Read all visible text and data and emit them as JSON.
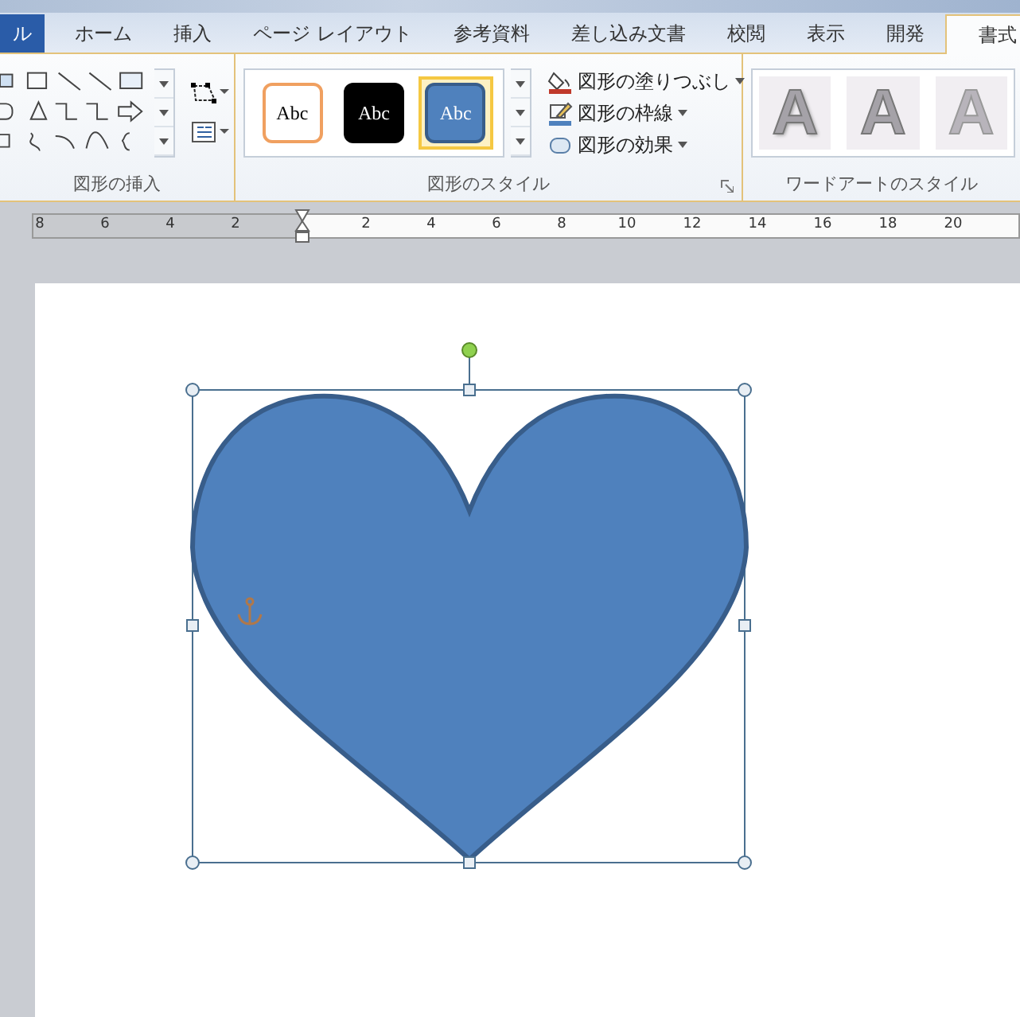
{
  "tabs": [
    {
      "label": "ル",
      "kind": "file",
      "selected": false
    },
    {
      "label": "ホーム",
      "kind": "tab",
      "selected": false
    },
    {
      "label": "挿入",
      "kind": "tab",
      "selected": false
    },
    {
      "label": "ページ レイアウト",
      "kind": "tab",
      "selected": false
    },
    {
      "label": "参考資料",
      "kind": "tab",
      "selected": false
    },
    {
      "label": "差し込み文書",
      "kind": "tab",
      "selected": false
    },
    {
      "label": "校閲",
      "kind": "tab",
      "selected": false
    },
    {
      "label": "表示",
      "kind": "tab",
      "selected": false
    },
    {
      "label": "開発",
      "kind": "tab",
      "selected": false
    },
    {
      "label": "書式",
      "kind": "tab",
      "selected": true
    }
  ],
  "insert_group": {
    "label": "図形の挿入"
  },
  "style_group": {
    "label": "図形のスタイル",
    "gallery": [
      {
        "label": "Abc",
        "kind": "outline",
        "selected": false
      },
      {
        "label": "Abc",
        "kind": "dark",
        "selected": false
      },
      {
        "label": "Abc",
        "kind": "blue",
        "selected": true
      }
    ],
    "commands": [
      {
        "label": "図形の塗りつぶし",
        "kind": "fill"
      },
      {
        "label": "図形の枠線",
        "kind": "outline"
      },
      {
        "label": "図形の効果",
        "kind": "effects"
      }
    ]
  },
  "wordart_group": {
    "label": "ワードアートのスタイル",
    "gallery": [
      {
        "label": "A",
        "kind": "shadow"
      },
      {
        "label": "A",
        "kind": "outline"
      },
      {
        "label": "A",
        "kind": "faint"
      }
    ]
  },
  "ruler": {
    "left_numbers": [
      "8",
      "6",
      "4",
      "2"
    ],
    "right_numbers": [
      "2",
      "4",
      "6",
      "8",
      "10",
      "12",
      "14",
      "16",
      "18",
      "20"
    ]
  }
}
